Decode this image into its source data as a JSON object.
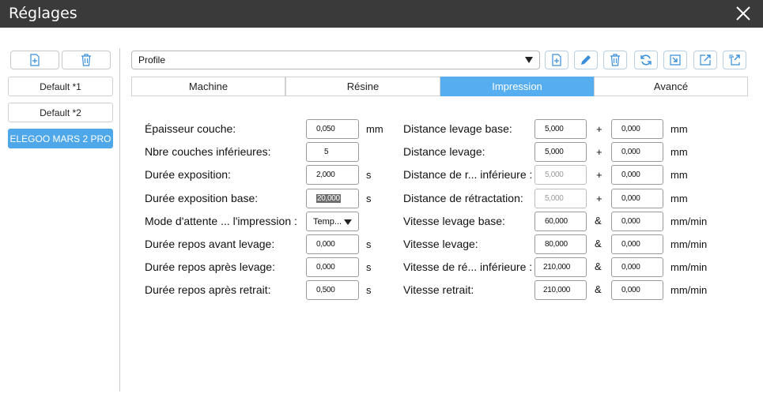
{
  "window": {
    "title": "Réglages"
  },
  "sidebar": {
    "profiles": [
      {
        "label": "Default *1"
      },
      {
        "label": "Default *2"
      },
      {
        "label": "ELEGOO MARS 2 PRO"
      }
    ],
    "active_index": 2
  },
  "toolbar": {
    "profile_select": "Profile",
    "tools": [
      "add-file-icon",
      "pencil-icon",
      "trash-icon",
      "refresh-icon",
      "import-icon",
      "export-icon",
      "export-all-icon"
    ]
  },
  "tabs": [
    {
      "label": "Machine"
    },
    {
      "label": "Résine"
    },
    {
      "label": "Impression"
    },
    {
      "label": "Avancé"
    }
  ],
  "active_tab": "Impression",
  "left_settings": [
    {
      "label": "Épaisseur couche:",
      "value": "0,050",
      "unit": "mm"
    },
    {
      "label": "Nbre couches inférieures:",
      "value": "5",
      "unit": ""
    },
    {
      "label": "Durée exposition:",
      "value": "2,000",
      "unit": "s"
    },
    {
      "label": "Durée exposition base:",
      "value": "20,000",
      "unit": "s"
    },
    {
      "label": "Mode d'attente ... l'impression :",
      "value": "Temp...",
      "unit": ""
    },
    {
      "label": "Durée repos avant levage:",
      "value": "0,000",
      "unit": "s"
    },
    {
      "label": "Durée repos après levage:",
      "value": "0,000",
      "unit": "s"
    },
    {
      "label": "Durée repos après retrait:",
      "value": "0,500",
      "unit": "s"
    }
  ],
  "right_settings": [
    {
      "label": "Distance levage base:",
      "value1": "5,000",
      "op": "+",
      "value2": "0,000",
      "unit": "mm"
    },
    {
      "label": "Distance levage:",
      "value1": "5,000",
      "op": "+",
      "value2": "0,000",
      "unit": "mm"
    },
    {
      "label": "Distance de r... inférieure :",
      "value1": "5,000",
      "op": "+",
      "value2": "0,000",
      "unit": "mm"
    },
    {
      "label": "Distance de rétractation:",
      "value1": "5,000",
      "op": "+",
      "value2": "0,000",
      "unit": "mm"
    },
    {
      "label": "Vitesse levage base:",
      "value1": "60,000",
      "op": "&",
      "value2": "0,000",
      "unit": "mm/min"
    },
    {
      "label": "Vitesse levage:",
      "value1": "80,000",
      "op": "&",
      "value2": "0,000",
      "unit": "mm/min"
    },
    {
      "label": "Vitesse de ré... inférieure :",
      "value1": "210,000",
      "op": "&",
      "value2": "0,000",
      "unit": "mm/min"
    },
    {
      "label": "Vitesse retrait:",
      "value1": "210,000",
      "op": "&",
      "value2": "0,000",
      "unit": "mm/min"
    }
  ],
  "colors": {
    "accent": "#56aef0",
    "titlebar": "#3a3a3a"
  }
}
